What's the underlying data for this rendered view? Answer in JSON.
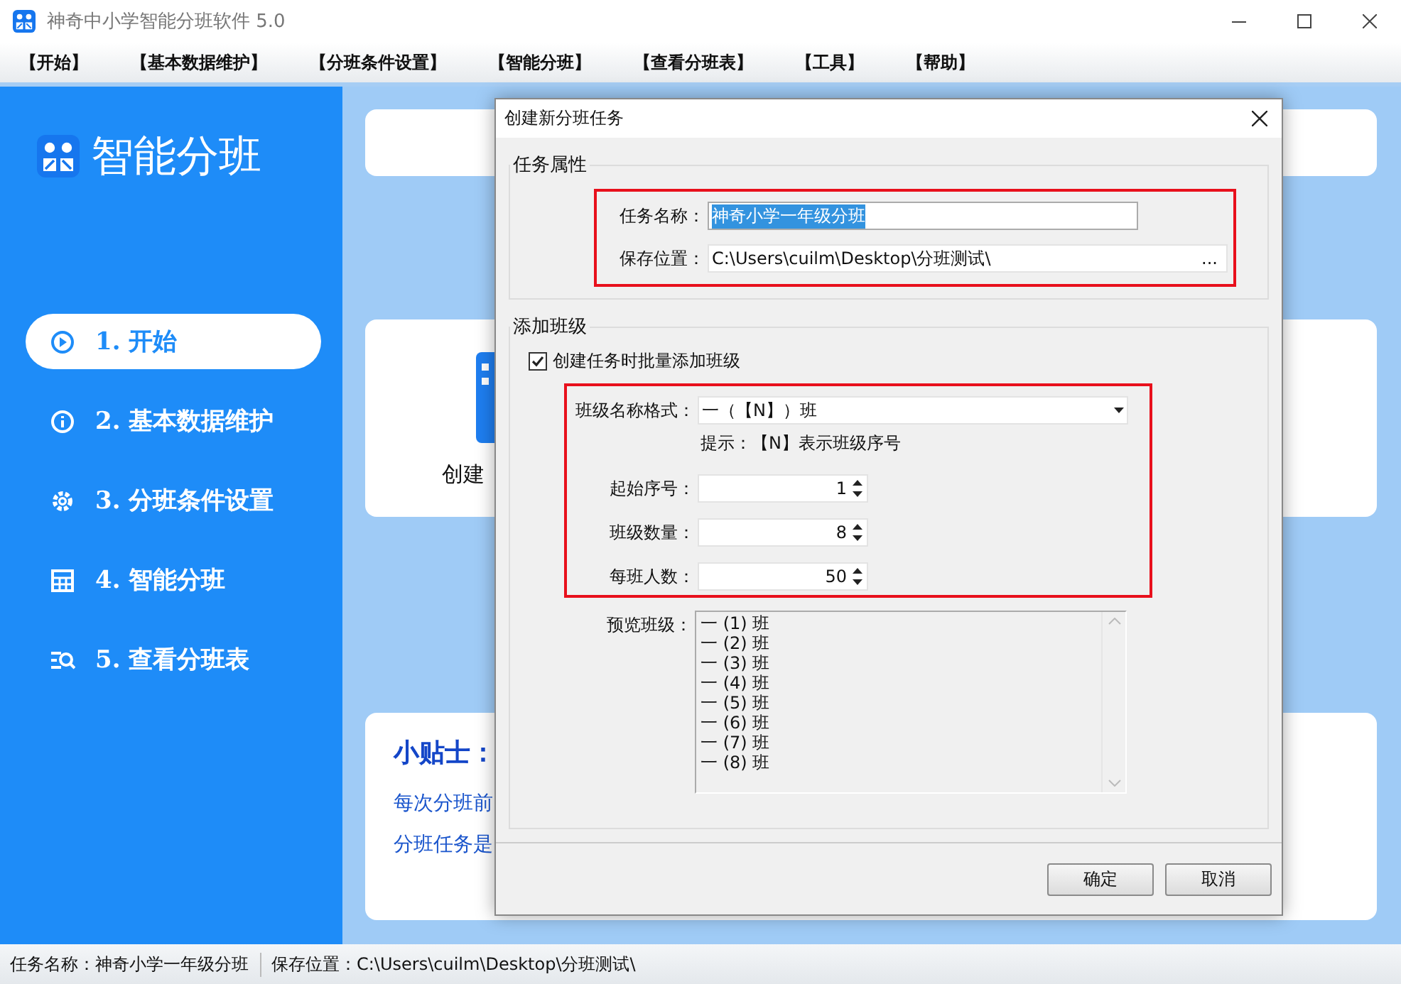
{
  "window": {
    "title": "神奇中小学智能分班软件 5.0"
  },
  "menu": [
    "【开始】",
    "【基本数据维护】",
    "【分班条件设置】",
    "【智能分班】",
    "【查看分班表】",
    "【工具】",
    "【帮助】"
  ],
  "sidebar": {
    "title": "智能分班",
    "items": [
      {
        "label": "1. 开始",
        "selected": true
      },
      {
        "label": "2. 基本数据维护",
        "selected": false
      },
      {
        "label": "3. 分班条件设置",
        "selected": false
      },
      {
        "label": "4. 智能分班",
        "selected": false
      },
      {
        "label": "5. 查看分班表",
        "selected": false
      }
    ]
  },
  "main": {
    "create_label": "创建",
    "tip_title": "小贴士：",
    "tip_lines": [
      "每次分班前",
      "分班任务是"
    ]
  },
  "dialog": {
    "title": "创建新分班任务",
    "task_group": {
      "title": "任务属性",
      "name_label": "任务名称：",
      "name_value": "神奇小学一年级分班",
      "name_selected": true,
      "path_label": "保存位置：",
      "path_value": "C:\\Users\\cuilm\\Desktop\\分班测试\\",
      "browse": "..."
    },
    "class_group": {
      "title": "添加班级",
      "batch": {
        "label": "创建任务时批量添加班级",
        "checked": true
      },
      "format_label": "班级名称格式：",
      "format_value": "一（【N】）班",
      "hint": "提示：【N】表示班级序号",
      "spinners": [
        {
          "label": "起始序号：",
          "value": "1"
        },
        {
          "label": "班级数量：",
          "value": "8"
        },
        {
          "label": "每班人数：",
          "value": "50"
        }
      ],
      "preview_label": "预览班级：",
      "preview": [
        "一 (1) 班",
        "一 (2) 班",
        "一 (3) 班",
        "一 (4) 班",
        "一 (5) 班",
        "一 (6) 班",
        "一 (7) 班",
        "一 (8) 班"
      ]
    },
    "buttons": [
      "确定",
      "取消"
    ]
  },
  "status_bar": [
    "任务名称：神奇小学一年级分班",
    "保存位置：C:\\Users\\cuilm\\Desktop\\分班测试\\"
  ]
}
